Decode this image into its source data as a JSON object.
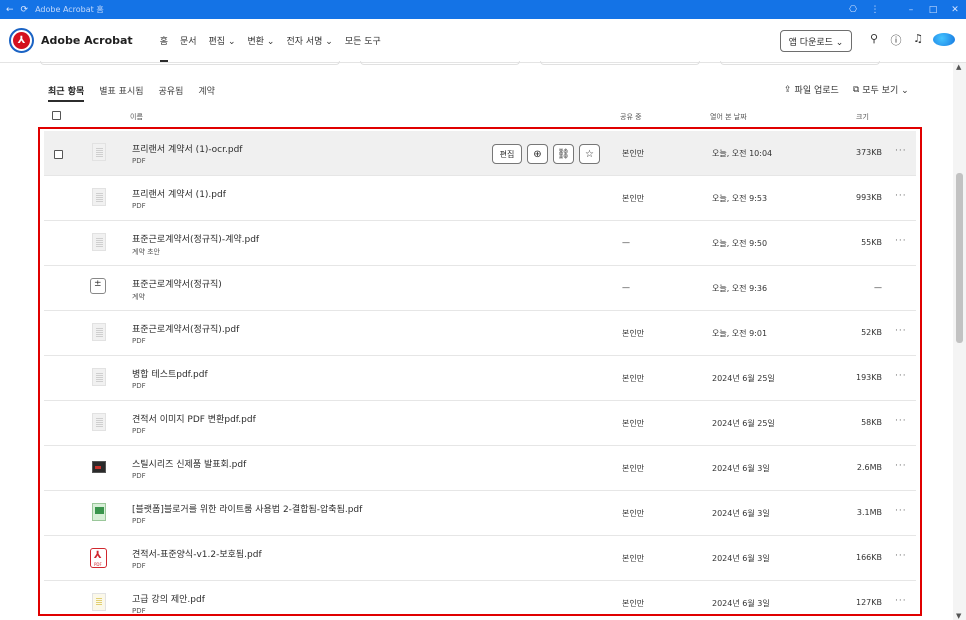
{
  "window": {
    "title": "Adobe Acrobat 홈",
    "back_icon": "back-arrow-icon",
    "refresh_icon": "refresh-icon"
  },
  "appbar": {
    "brand": "Adobe Acrobat",
    "nav": [
      "홈",
      "문서",
      "편집 ⌄",
      "변환 ⌄",
      "전자 서명 ⌄",
      "모든 도구"
    ],
    "download_label": "앱 다운로드 ⌄"
  },
  "tabs": [
    "최근 항목",
    "별표 표시됨",
    "공유됨",
    "계약"
  ],
  "tab_actions": {
    "upload_label": "파일 업로드",
    "view_all_label": "모두 보기 ⌄"
  },
  "headers": {
    "name": "이름",
    "sharing": "공유 중",
    "opened": "열어 본 날짜",
    "size": "크기"
  },
  "row_actions": {
    "edit_label": "편집"
  },
  "files": [
    {
      "name": "프리랜서 계약서 (1)-ocr.pdf",
      "type": "PDF",
      "shared": "본인만",
      "opened": "오늘, 오전 10:04",
      "size": "373KB",
      "thumb": "doc",
      "more": "···"
    },
    {
      "name": "프리랜서 계약서 (1).pdf",
      "type": "PDF",
      "shared": "본인만",
      "opened": "오늘, 오전 9:53",
      "size": "993KB",
      "thumb": "doc",
      "more": "···"
    },
    {
      "name": "표준근로계약서(정규직)-계약.pdf",
      "type": "계약 초안",
      "shared": "—",
      "opened": "오늘, 오전 9:50",
      "size": "55KB",
      "thumb": "doc",
      "more": "···"
    },
    {
      "name": "표준근로계약서(정규직)",
      "type": "계약",
      "shared": "—",
      "opened": "오늘, 오전 9:36",
      "size": "—",
      "thumb": "sign",
      "more": ""
    },
    {
      "name": "표준근로계약서(정규직).pdf",
      "type": "PDF",
      "shared": "본인만",
      "opened": "오늘, 오전 9:01",
      "size": "52KB",
      "thumb": "doc",
      "more": "···"
    },
    {
      "name": "병합 테스트pdf.pdf",
      "type": "PDF",
      "shared": "본인만",
      "opened": "2024년 6월 25일",
      "size": "193KB",
      "thumb": "doc",
      "more": "···"
    },
    {
      "name": "견적서 이미지 PDF 변환pdf.pdf",
      "type": "PDF",
      "shared": "본인만",
      "opened": "2024년 6월 25일",
      "size": "58KB",
      "thumb": "doc",
      "more": "···"
    },
    {
      "name": "스틸시리즈 신제품 발표회.pdf",
      "type": "PDF",
      "shared": "본인만",
      "opened": "2024년 6월 3일",
      "size": "2.6MB",
      "thumb": "photo",
      "more": "···"
    },
    {
      "name": "[블랫폼]블로거를 위한 라이트룸 사용법 2-결합됨-압축됨.pdf",
      "type": "PDF",
      "shared": "본인만",
      "opened": "2024년 6월 3일",
      "size": "3.1MB",
      "thumb": "green",
      "more": "···"
    },
    {
      "name": "견적서-표준양식-v1.2-보호됨.pdf",
      "type": "PDF",
      "shared": "본인만",
      "opened": "2024년 6월 3일",
      "size": "166KB",
      "thumb": "pdf",
      "more": "···"
    },
    {
      "name": "고급 강의 제안.pdf",
      "type": "PDF",
      "shared": "본인만",
      "opened": "2024년 6월 3일",
      "size": "127KB",
      "thumb": "yellow",
      "more": "···"
    }
  ],
  "colors": {
    "titlebar": "#1473e6",
    "highlight_border": "#e00000",
    "acrobat_red": "#d4101e"
  }
}
